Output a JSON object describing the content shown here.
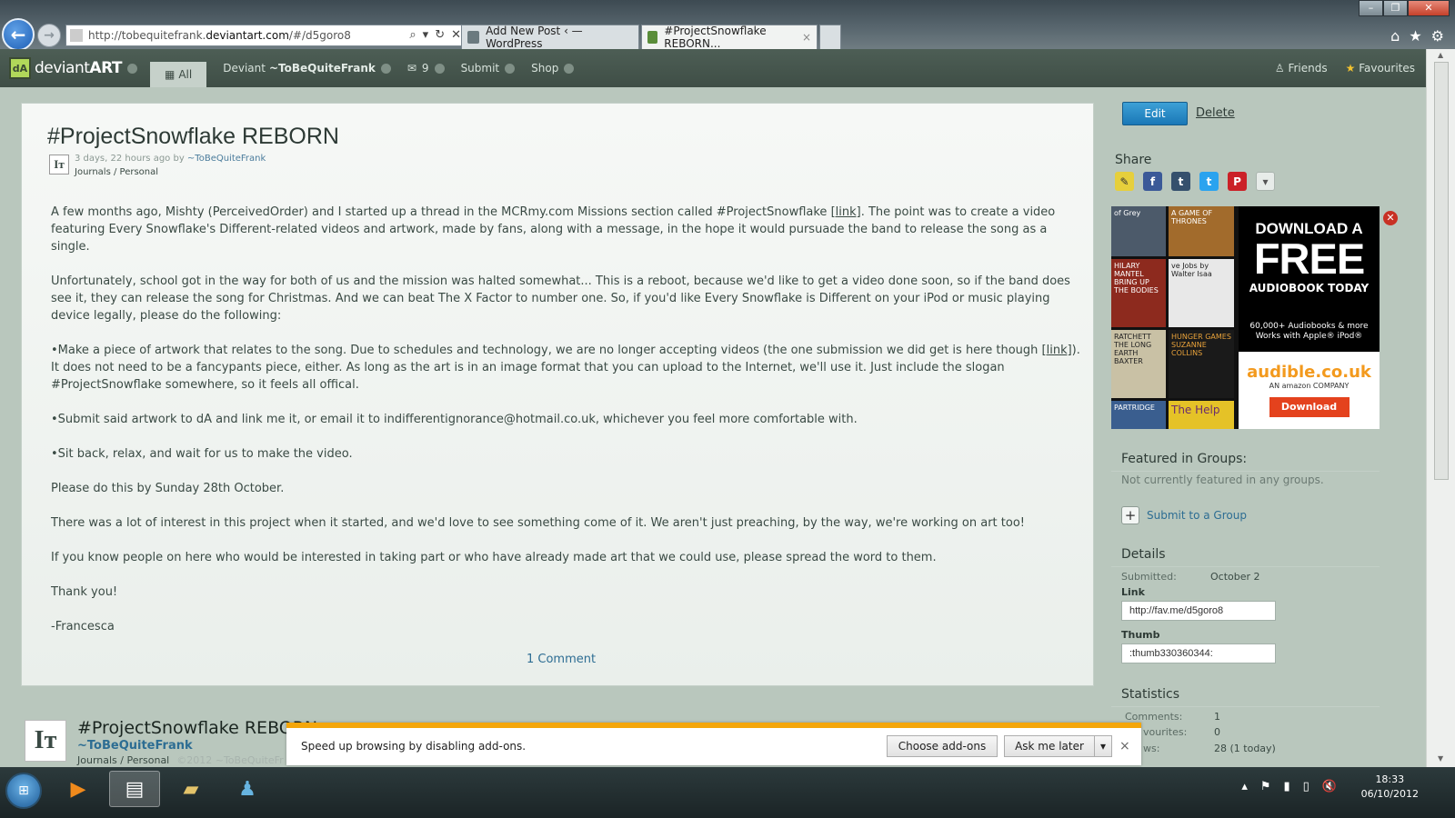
{
  "browser": {
    "url_prefix": "http://tobequitefrank.",
    "url_host": "deviantart.com",
    "url_suffix": "/#/d5goro8",
    "tabs": [
      {
        "label": "Add New Post ‹ — WordPress"
      },
      {
        "label": "#ProjectSnowflake REBORN..."
      }
    ],
    "tab_close": "×"
  },
  "danav": {
    "logo_text_a": "deviant",
    "logo_text_b": "ART",
    "all_label": "All",
    "deviant_label": "Deviant",
    "deviant_user": "~ToBeQuiteFrank",
    "messages_count": "9",
    "submit_label": "Submit",
    "shop_label": "Shop",
    "friends_label": "Friends",
    "favourites_label": "Favourites"
  },
  "post": {
    "title": "#ProjectSnowflake REBORN",
    "time": "3 days, 22 hours ago by ",
    "author": "~ToBeQuiteFrank",
    "category": "Journals / Personal",
    "paragraphs": [
      {
        "pre": "A few months ago, Mishty (PerceivedOrder) and I started up a thread in the MCRmy.com Missions section called #ProjectSnowflake ",
        "link": "[link]",
        "post": ". The point was to create a video featuring Every Snowflake's Different-related videos and artwork, made by fans, along with a message, in the hope it would pursuade the band to release the song as a single."
      },
      {
        "pre": "Unfortunately, school got in the way for both of us and the mission was halted somewhat... This is a reboot, because we'd like to get a video done soon, so if the band does see it, they can release the song for Christmas. And we can beat The X Factor to number one. So, if you'd like Every Snowflake is Different on your iPod or music playing device legally, please do the following:",
        "link": "",
        "post": ""
      },
      {
        "pre": "•Make a piece of artwork that relates to the song. Due to schedules and technology, we are no longer accepting videos (the one submission we did get is here though ",
        "link": "[link]",
        "post": "). It does not need to be a fancypants piece, either. As long as the art is in an image format that you can upload to the Internet, we'll use it. Just include the slogan #ProjectSnowflake somewhere, so it feels all offical."
      },
      {
        "pre": "•Submit said artwork to dA and link me it, or email it to indifferentignorance@hotmail.co.uk, whichever you feel more comfortable with.",
        "link": "",
        "post": ""
      },
      {
        "pre": "•Sit back, relax, and wait for us to make the video.",
        "link": "",
        "post": ""
      },
      {
        "pre": "Please do this by Sunday 28th October.",
        "link": "",
        "post": ""
      },
      {
        "pre": "There was a lot of interest in this project when it started, and we'd love to see something come of it. We aren't just preaching, by the way, we're working on art too!",
        "link": "",
        "post": ""
      },
      {
        "pre": "If you know people on here who would be interested in taking part or who have already made art that we could use, please spread the word to them.",
        "link": "",
        "post": ""
      },
      {
        "pre": "Thank you!",
        "link": "",
        "post": ""
      },
      {
        "pre": "-Francesca",
        "link": "",
        "post": ""
      }
    ],
    "comments_link": "1 Comment"
  },
  "sticky": {
    "title": "#ProjectSnowflake REBORN",
    "user": "~ToBeQuiteFrank",
    "category": "Journals / Personal",
    "copyright": "©2012 ~ToBeQuiteFr"
  },
  "sidebar": {
    "edit_label": "Edit",
    "delete_label": "Delete",
    "share_label": "Share",
    "featured_heading": "Featured in Groups:",
    "featured_text": "Not currently featured in any groups.",
    "submit_group_label": "Submit to a Group",
    "details_heading": "Details",
    "submitted_label": "Submitted:",
    "submitted_value": "October 2",
    "link_label": "Link",
    "link_value": "http://fav.me/d5goro8",
    "thumb_label": "Thumb",
    "thumb_value": ":thumb330360344:",
    "statistics_heading": "Statistics",
    "stats": [
      {
        "label": "Comments:",
        "value": "1"
      },
      {
        "label": "vourites:",
        "value": "0"
      },
      {
        "label": "ws:",
        "value": "28 (1 today)"
      }
    ]
  },
  "ad": {
    "headline": "DOWNLOAD A",
    "free": "FREE",
    "sub": "AUDIOBOOK TODAY",
    "small": "60,000+ Audiobooks & more Works with Apple® iPod®",
    "brand": "audible.co.uk",
    "amazon": "AN amazon COMPANY",
    "button": "Download",
    "covers": [
      "of Grey",
      "A GAME OF THRONES",
      "HILARY MANTEL BRING UP THE BODIES",
      "ve Jobs by Walter Isaa",
      "RATCHETT THE LONG EARTH BAXTER",
      "HUNGER GAMES SUZANNE COLLINS",
      "PARTRIDGE",
      "The Help"
    ]
  },
  "notification": {
    "text": "Speed up browsing by disabling add-ons.",
    "choose_label": "Choose add-ons",
    "later_label": "Ask me later",
    "close": "×"
  },
  "taskbar": {
    "time": "18:33",
    "date": "06/10/2012"
  }
}
